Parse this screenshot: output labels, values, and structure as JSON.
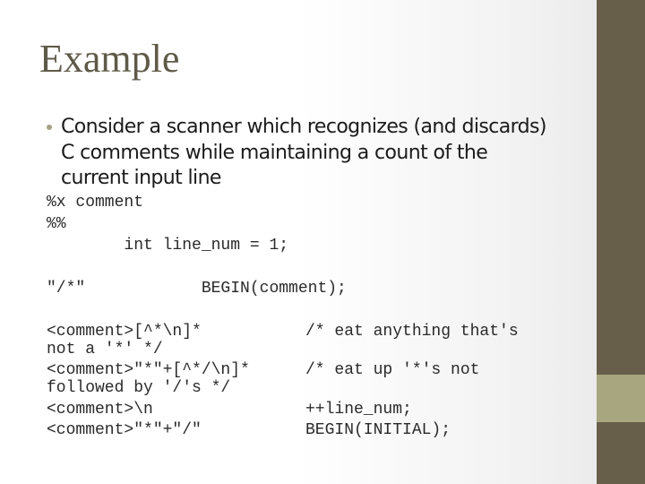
{
  "slide": {
    "title": "Example",
    "bullet": "Consider a scanner which recognizes (and discards) C comments while maintaining a count of the current input line",
    "code_lines": [
      "%x comment",
      "%%",
      "        int line_num = 1;",
      "\"/*\"            BEGIN(comment);",
      "<comment>[^*\\n]*",
      "not a '*' */",
      "<comment>\"*\"+[^*/\\n]*",
      "followed by '/'s */",
      "<comment>\\n",
      "<comment>\"*\"+\"/\""
    ],
    "code_actions": [
      "/* eat anything that's",
      "/* eat up '*'s not",
      "++line_num;",
      "BEGIN(INITIAL);"
    ]
  },
  "theme": {
    "sidebar_color": "#675f4a",
    "sidebar_band_color": "#a8a67f",
    "title_color": "#5f5a48"
  }
}
